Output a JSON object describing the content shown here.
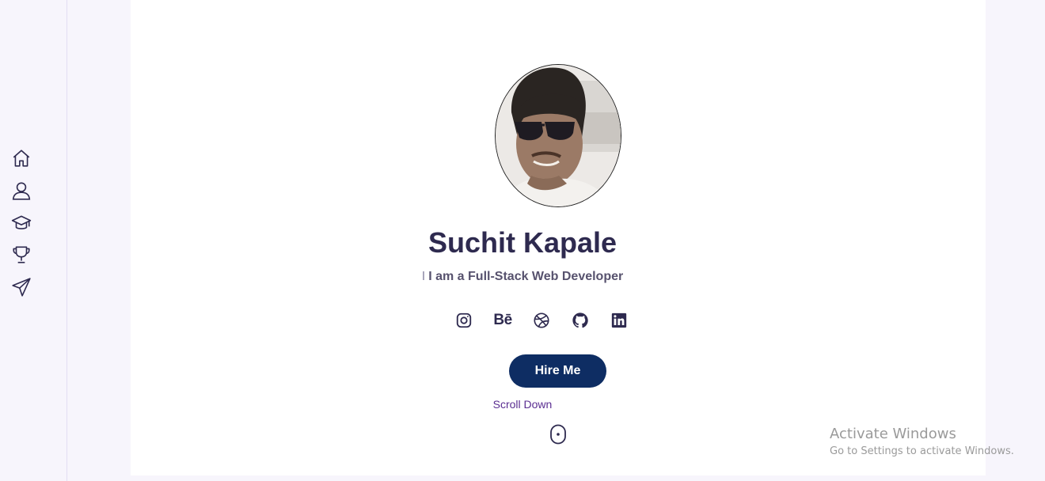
{
  "sidebar": {
    "items": [
      {
        "icon": "home-icon"
      },
      {
        "icon": "user-icon"
      },
      {
        "icon": "graduation-cap-icon"
      },
      {
        "icon": "trophy-icon"
      },
      {
        "icon": "send-icon"
      }
    ]
  },
  "profile": {
    "name": "Suchit Kapale",
    "tagline_cursor": "I",
    "tagline": "I am a Full-Stack Web Developer"
  },
  "socials": [
    {
      "icon": "instagram-icon"
    },
    {
      "icon": "behance-icon",
      "text": "Bē"
    },
    {
      "icon": "dribbble-icon"
    },
    {
      "icon": "github-icon"
    },
    {
      "icon": "linkedin-icon"
    }
  ],
  "actions": {
    "hire_label": "Hire Me",
    "scroll_label": "Scroll Down"
  },
  "watermark": {
    "title": "Activate Windows",
    "subtitle": "Go to Settings to activate Windows."
  },
  "colors": {
    "accent": "#0e2d63",
    "text": "#2e2a4f",
    "scroll_text": "#5a2d91",
    "background": "#f7f5fc"
  }
}
